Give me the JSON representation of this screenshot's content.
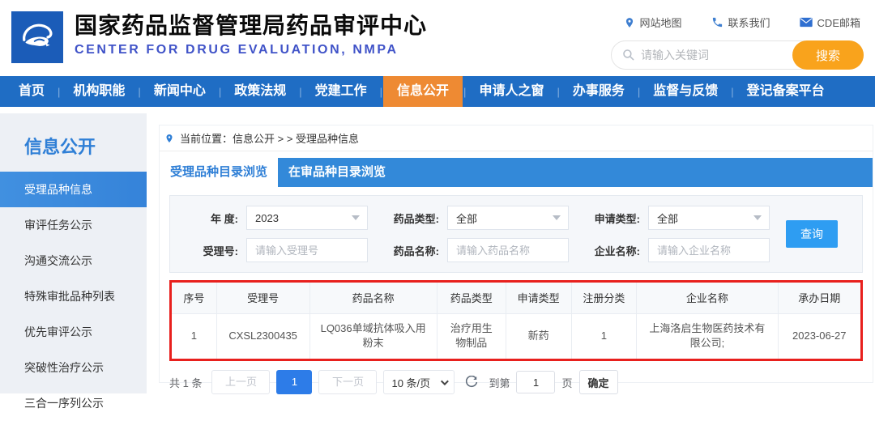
{
  "header": {
    "title": "国家药品监督管理局药品审评中心",
    "subtitle": "CENTER FOR DRUG EVALUATION, NMPA",
    "links": {
      "sitemap": "网站地图",
      "contact": "联系我们",
      "mailbox": "CDE邮箱"
    },
    "search": {
      "placeholder": "请输入关键词",
      "button": "搜索"
    }
  },
  "nav": {
    "items": [
      "首页",
      "机构职能",
      "新闻中心",
      "政策法规",
      "党建工作",
      "信息公开",
      "申请人之窗",
      "办事服务",
      "监督与反馈",
      "登记备案平台"
    ],
    "active": "信息公开"
  },
  "sidebar": {
    "title": "信息公开",
    "items": [
      "受理品种信息",
      "审评任务公示",
      "沟通交流公示",
      "特殊审批品种列表",
      "优先审评公示",
      "突破性治疗公示",
      "三合一序列公示"
    ],
    "active": "受理品种信息"
  },
  "main": {
    "breadcrumb": "当前位置：信息公开 > > 受理品种信息",
    "tabs": [
      "受理品种目录浏览",
      "在审品种目录浏览"
    ],
    "active_tab": "受理品种目录浏览",
    "filters": {
      "year": {
        "label": "年 度:",
        "value": "2023"
      },
      "drug_type": {
        "label": "药品类型:",
        "value": "全部"
      },
      "apply_type": {
        "label": "申请类型:",
        "value": "全部"
      },
      "accept_no": {
        "label": "受理号:",
        "placeholder": "请输入受理号"
      },
      "drug_name": {
        "label": "药品名称:",
        "placeholder": "请输入药品名称"
      },
      "company": {
        "label": "企业名称:",
        "placeholder": "请输入企业名称"
      },
      "query_button": "查询"
    },
    "table": {
      "columns": [
        "序号",
        "受理号",
        "药品名称",
        "药品类型",
        "申请类型",
        "注册分类",
        "企业名称",
        "承办日期"
      ],
      "rows": [
        [
          "1",
          "CXSL2300435",
          "LQ036单域抗体吸入用粉末",
          "治疗用生物制品",
          "新药",
          "1",
          "上海洛启生物医药技术有限公司;",
          "2023-06-27"
        ]
      ]
    },
    "pagination": {
      "total": "共 1 条",
      "prev": "上一页",
      "current_page": "1",
      "next": "下一页",
      "page_size": "10 条/页",
      "goto_prefix": "到第",
      "goto_value": "1",
      "goto_suffix": "页",
      "confirm": "确定"
    }
  },
  "colors": {
    "nav_blue": "#1f6dc4",
    "nav_active_orange": "#ee8a33",
    "search_orange": "#f9a31c",
    "tab_blue": "#3389d9",
    "sidebar_active_blue": "#3b89dc",
    "query_button_blue": "#2e9df2",
    "page_active_blue": "#2d7ce8",
    "annotation_red": "#e8201d",
    "icon_blue": "#3f7fd0",
    "subtitle_blue": "#4053c8"
  }
}
